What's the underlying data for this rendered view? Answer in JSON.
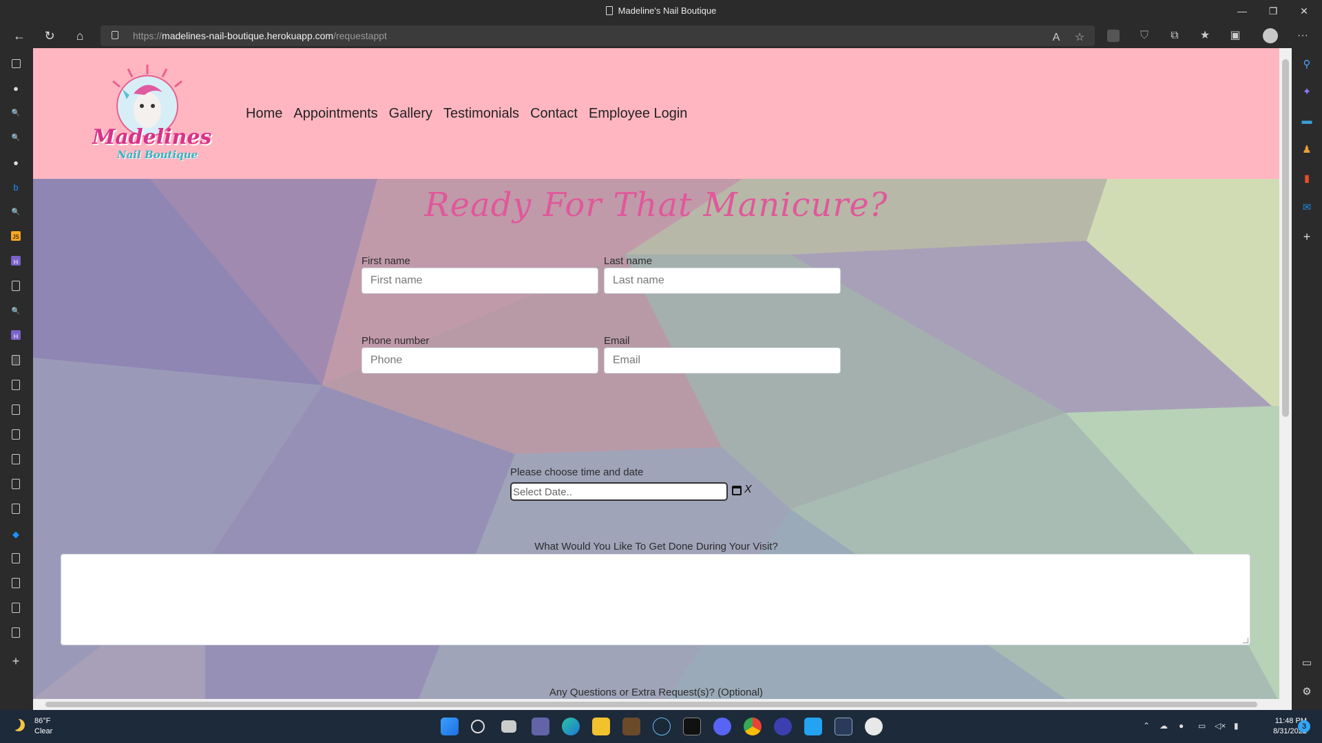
{
  "window": {
    "title": "Madeline's Nail Boutique",
    "minimize": "—",
    "restore": "❐",
    "close": "✕"
  },
  "browser": {
    "url_prefix": "https://",
    "url_host": "madelines-nail-boutique.herokuapp.com",
    "url_path": "/requestappt",
    "back_icon": "←",
    "refresh_icon": "↻",
    "home_icon": "⌂",
    "read_aloud_icon": "A",
    "favorite_icon": "☆",
    "extensions_icon": "⧉",
    "favorites_icon": "★",
    "collections_icon": "▣",
    "more_icon": "···"
  },
  "site": {
    "logo_text_1": "Madelines",
    "logo_text_2": "Nail Boutique",
    "nav": [
      "Home",
      "Appointments",
      "Gallery",
      "Testimonials",
      "Contact",
      "Employee Login"
    ],
    "heading": "Ready For That Manicure?",
    "form": {
      "first_name_label": "First name",
      "first_name_placeholder": "First name",
      "last_name_label": "Last name",
      "last_name_placeholder": "Last name",
      "phone_label": "Phone number",
      "phone_placeholder": "Phone",
      "email_label": "Email",
      "email_placeholder": "Email",
      "date_label": "Please choose time and date",
      "date_placeholder": "Select Date..",
      "clear_label": "X",
      "visit_label": "What Would You Like To Get Done During Your Visit?",
      "extra_label": "Any Questions or Extra Request(s)? (Optional)"
    }
  },
  "taskbar": {
    "temperature": "86°F",
    "condition": "Clear",
    "time": "11:48 PM",
    "date": "8/31/2022",
    "notifications": "3"
  },
  "colors": {
    "header_pink": "#ffb6c1",
    "heading_pink": "#e0589a",
    "browser_chrome": "#2b2b2b",
    "taskbar": "#1c2a3a"
  }
}
